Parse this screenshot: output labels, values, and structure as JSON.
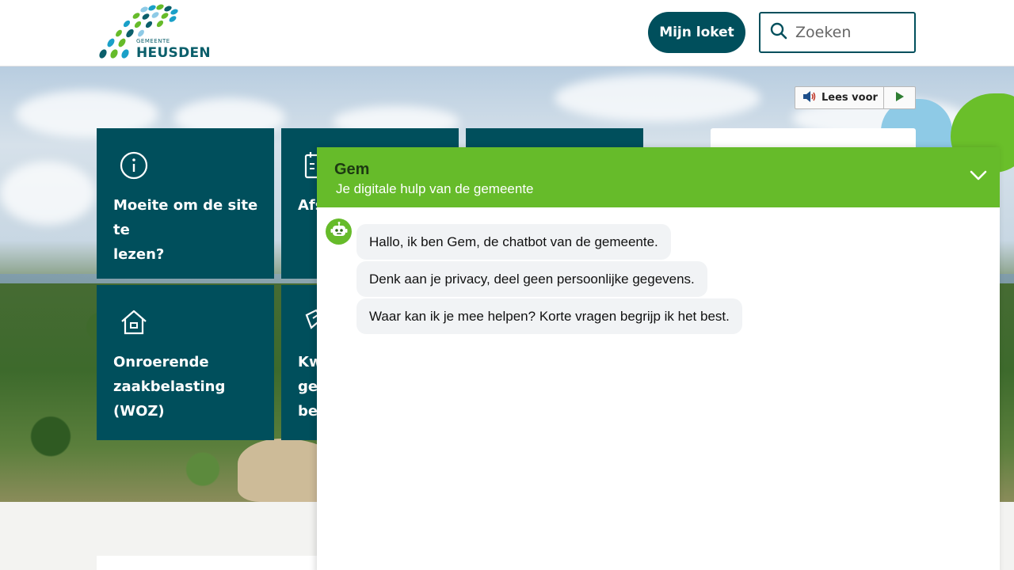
{
  "header": {
    "logo_small": "GEMEENTE",
    "logo_name": "HEUSDEN",
    "loket_button": "Mijn loket",
    "search_placeholder": "Zoeken"
  },
  "readspeaker": {
    "label": "Lees voor"
  },
  "tiles": [
    {
      "label_lines": [
        "Moeite om de site te",
        "lezen?"
      ],
      "icon": "info-icon"
    },
    {
      "label_lines": [
        "Afs"
      ],
      "icon": "calendar-icon"
    },
    {
      "label_lines": [],
      "icon": ""
    },
    {
      "label_lines": [
        "Onroerende",
        "zaakbelasting (WOZ)"
      ],
      "icon": "house-icon"
    },
    {
      "label_lines": [
        "Kw",
        "ge",
        "be"
      ],
      "icon": "document-icon"
    }
  ],
  "chat": {
    "title": "Gem",
    "subtitle": "Je digitale hulp van de gemeente",
    "messages": [
      "Hallo, ik ben Gem, de chatbot van de gemeente.",
      "Denk aan je privacy, deel geen persoonlijke gegevens.",
      "Waar kan ik je mee helpen? Korte vragen begrijp ik het best."
    ]
  },
  "colors": {
    "brand_teal": "#004f5c",
    "chat_green": "#66bb2a",
    "bubble_bg": "#f1f3f5"
  }
}
